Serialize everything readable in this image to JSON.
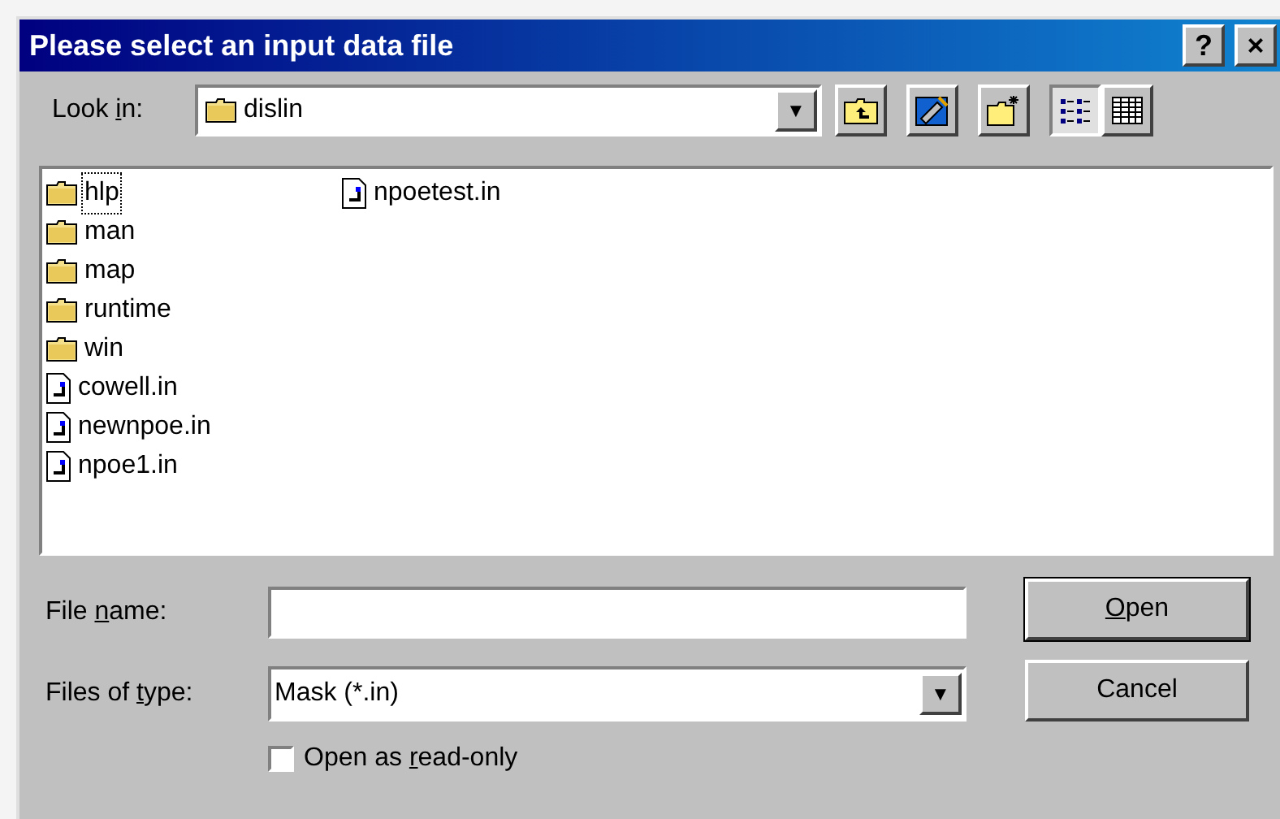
{
  "window": {
    "title": "Please select an input data file",
    "title_buttons": [
      "?",
      "×"
    ]
  },
  "look_in": {
    "label_parts": [
      {
        "text": "Look ",
        "underlined": false
      },
      {
        "text": "i",
        "underlined": true
      },
      {
        "text": "n:",
        "underlined": false
      }
    ],
    "value": "dislin",
    "dropdown_arrow": "▼"
  },
  "toolbar": [
    {
      "kind": "up",
      "selected": false
    },
    {
      "kind": "desktop",
      "selected": false
    },
    {
      "kind": "newfolder",
      "selected": false
    },
    {
      "kind": "list",
      "selected": true
    },
    {
      "kind": "details",
      "selected": false
    }
  ],
  "files": {
    "columns": [
      [
        {
          "name": "hlp",
          "kind": "folder",
          "focused": true
        },
        {
          "name": "man",
          "kind": "folder",
          "focused": false
        },
        {
          "name": "map",
          "kind": "folder",
          "focused": false
        },
        {
          "name": "runtime",
          "kind": "folder",
          "focused": false
        },
        {
          "name": "win",
          "kind": "folder",
          "focused": false
        },
        {
          "name": "cowell.in",
          "kind": "file",
          "focused": false
        },
        {
          "name": "newnpoe.in",
          "kind": "file",
          "focused": false
        },
        {
          "name": "npoe1.in",
          "kind": "file",
          "focused": false
        }
      ],
      [
        {
          "name": "npoetest.in",
          "kind": "file",
          "focused": false
        }
      ]
    ]
  },
  "file_name": {
    "label_parts": [
      {
        "text": "File ",
        "underlined": false
      },
      {
        "text": "n",
        "underlined": true
      },
      {
        "text": "ame:",
        "underlined": false
      }
    ]
  },
  "file_type": {
    "label_parts": [
      {
        "text": "Files of ",
        "underlined": false
      },
      {
        "text": "t",
        "underlined": true
      },
      {
        "text": "ype:",
        "underlined": false
      }
    ],
    "value": "Mask (*.in)",
    "dropdown_arrow": "▼"
  },
  "read_only": {
    "label_parts": [
      {
        "text": "Open as ",
        "underlined": false
      },
      {
        "text": "r",
        "underlined": true
      },
      {
        "text": "ead-only",
        "underlined": false
      }
    ],
    "checked": false
  },
  "buttons": [
    {
      "label_parts": [
        {
          "text": "O",
          "underlined": true
        },
        {
          "text": "pen",
          "underlined": false
        }
      ],
      "default": true
    },
    {
      "label_parts": [
        {
          "text": "Cancel",
          "underlined": false
        }
      ],
      "default": false
    }
  ]
}
